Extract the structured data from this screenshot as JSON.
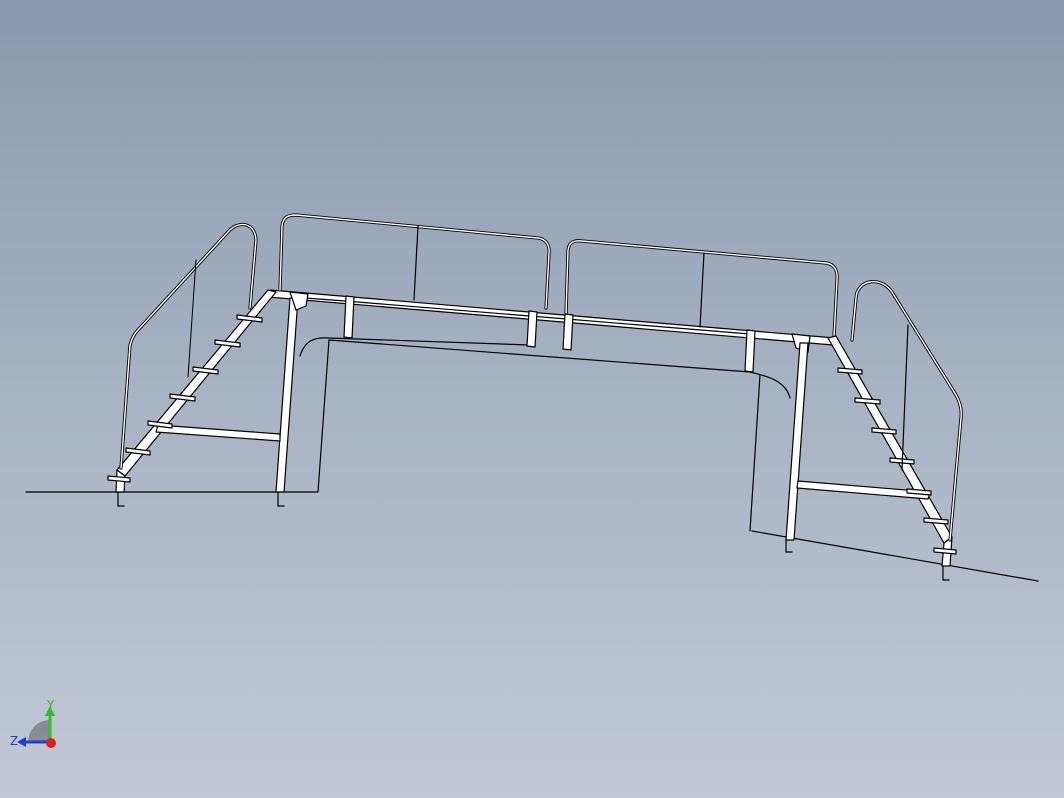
{
  "viewport": {
    "background_top": "#8a9aae",
    "background_bottom": "#c3c9d5"
  },
  "triad": {
    "y_label": "Y",
    "z_label": "Z",
    "y_color": "#2dbf2d",
    "z_color": "#1f3fd1",
    "origin_color": "#e01b1b"
  },
  "model": {
    "line_color": "#000000",
    "fill_color": "#ffffff"
  }
}
